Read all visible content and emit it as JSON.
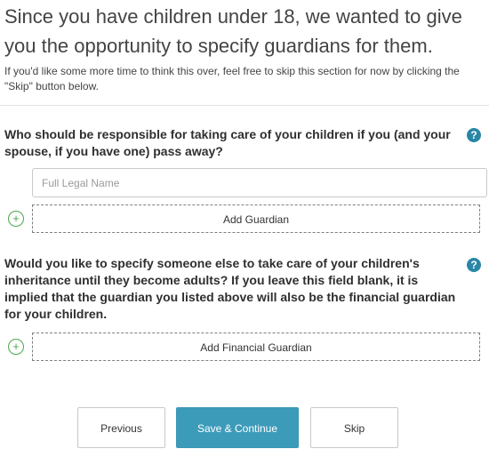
{
  "intro": {
    "title": "Since you have children under 18, we wanted to give you the opportunity to specify guardians for them.",
    "subtitle": "If you'd like some more time to think this over, feel free to skip this section for now by clicking the \"Skip\" button below."
  },
  "guardian_section": {
    "question": "Who should be responsible for taking care of your children if you (and your spouse, if you have one) pass away?",
    "help_icon": "question-circle",
    "name_field": {
      "placeholder": "Full Legal Name",
      "value": ""
    },
    "add_icon": "plus-circle",
    "add_button_label": "Add Guardian"
  },
  "financial_section": {
    "question": "Would you like to specify someone else to take care of your children's inheritance until they become adults? If you leave this field blank, it is implied that the guardian you listed above will also be the financial guardian for your children.",
    "help_icon": "question-circle",
    "add_icon": "plus-circle",
    "add_button_label": "Add Financial Guardian"
  },
  "footer": {
    "previous_label": "Previous",
    "save_label": "Save & Continue",
    "skip_label": "Skip"
  },
  "colors": {
    "accent": "#3d9bba",
    "help_icon": "#2a86a6",
    "plus_icon": "#4aa84a"
  }
}
